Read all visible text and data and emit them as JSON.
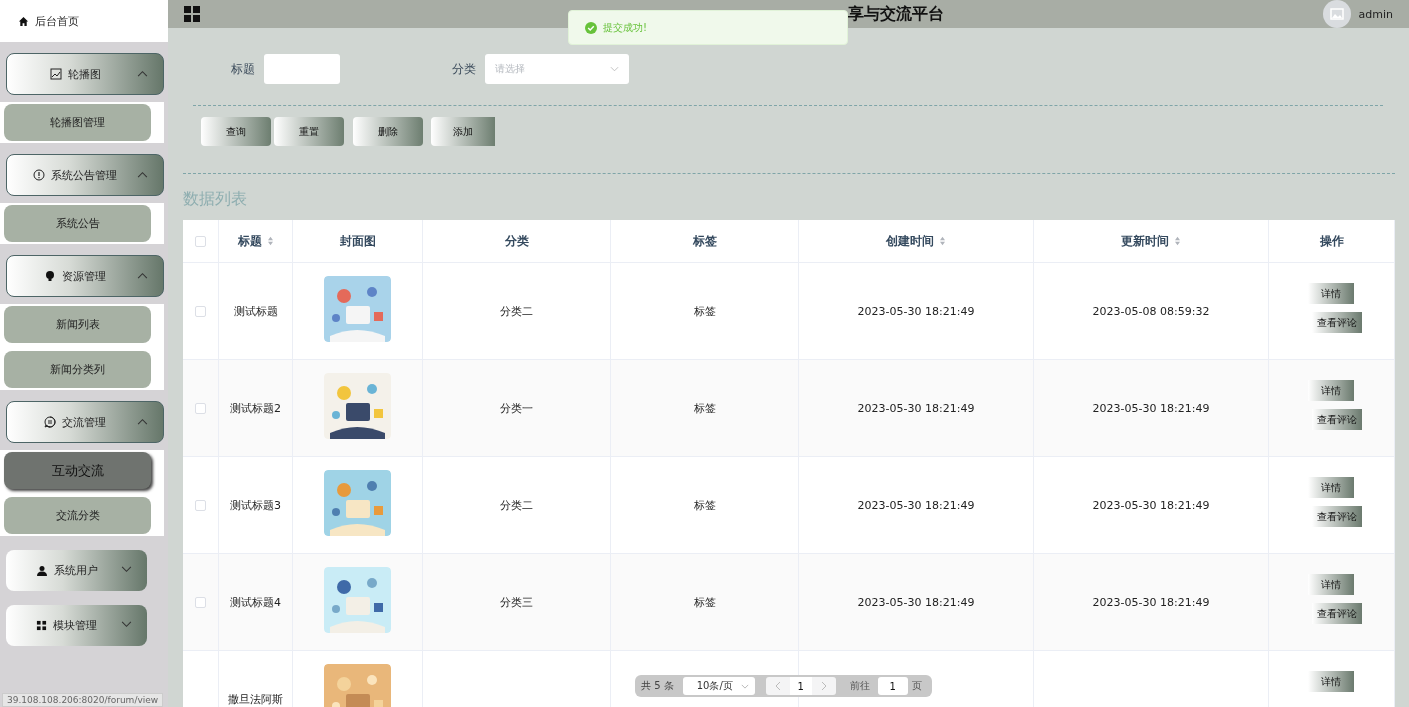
{
  "sidebar": {
    "home": "后台首页",
    "groups": [
      {
        "label": "轮播图",
        "expanded": true,
        "items": [
          {
            "label": "轮播图管理",
            "selected": false
          }
        ]
      },
      {
        "label": "系统公告管理",
        "expanded": true,
        "items": [
          {
            "label": "系统公告",
            "selected": false
          }
        ]
      },
      {
        "label": "资源管理",
        "expanded": true,
        "items": [
          {
            "label": "新闻列表",
            "selected": false
          },
          {
            "label": "新闻分类列",
            "selected": false
          }
        ]
      },
      {
        "label": "交流管理",
        "expanded": true,
        "items": [
          {
            "label": "互动交流",
            "selected": true
          },
          {
            "label": "交流分类",
            "selected": false
          }
        ]
      },
      {
        "label": "系统用户",
        "expanded": false
      },
      {
        "label": "模块管理",
        "expanded": false
      }
    ],
    "status_url": "39.108.108.206:8020/forum/view"
  },
  "header": {
    "title": "享与交流平台",
    "user": "admin"
  },
  "toast": {
    "message": "提交成功!"
  },
  "search": {
    "fields": [
      {
        "label": "标题",
        "kind": "text"
      },
      {
        "label": "分类",
        "kind": "select",
        "placeholder": "请选择"
      }
    ]
  },
  "actions": [
    "查询",
    "重置",
    "删除",
    "添加"
  ],
  "table": {
    "title": "数据列表",
    "all_checked": false,
    "columns": [
      {
        "label": "标题",
        "sortable": true
      },
      {
        "label": "封面图",
        "sortable": false
      },
      {
        "label": "分类",
        "sortable": false
      },
      {
        "label": "标签",
        "sortable": false
      },
      {
        "label": "创建时间",
        "sortable": true
      },
      {
        "label": "更新时间",
        "sortable": true
      },
      {
        "label": "操作",
        "sortable": false
      }
    ],
    "rows": [
      {
        "checked": false,
        "title": "测试标题",
        "category": "分类二",
        "tag": "标签",
        "created": "2023-05-30 18:21:49",
        "updated": "2023-05-08 08:59:32",
        "actions": [
          "详情",
          "查看评论"
        ]
      },
      {
        "checked": false,
        "title": "测试标题2",
        "category": "分类一",
        "tag": "标签",
        "created": "2023-05-30 18:21:49",
        "updated": "2023-05-30 18:21:49",
        "actions": [
          "详情",
          "查看评论"
        ]
      },
      {
        "checked": false,
        "title": "测试标题3",
        "category": "分类二",
        "tag": "标签",
        "created": "2023-05-30 18:21:49",
        "updated": "2023-05-30 18:21:49",
        "actions": [
          "详情",
          "查看评论"
        ]
      },
      {
        "checked": false,
        "title": "测试标题4",
        "category": "分类三",
        "tag": "标签",
        "created": "2023-05-30 18:21:49",
        "updated": "2023-05-30 18:21:49",
        "actions": [
          "详情",
          "查看评论"
        ]
      },
      {
        "title": "撒旦法阿斯",
        "actions": [
          "详情"
        ]
      }
    ]
  },
  "pagination": {
    "total": "共 5 条",
    "page_size": "10条/页",
    "page": "1",
    "goto_label": "前往",
    "goto_value": "1",
    "page_suffix": "页"
  }
}
